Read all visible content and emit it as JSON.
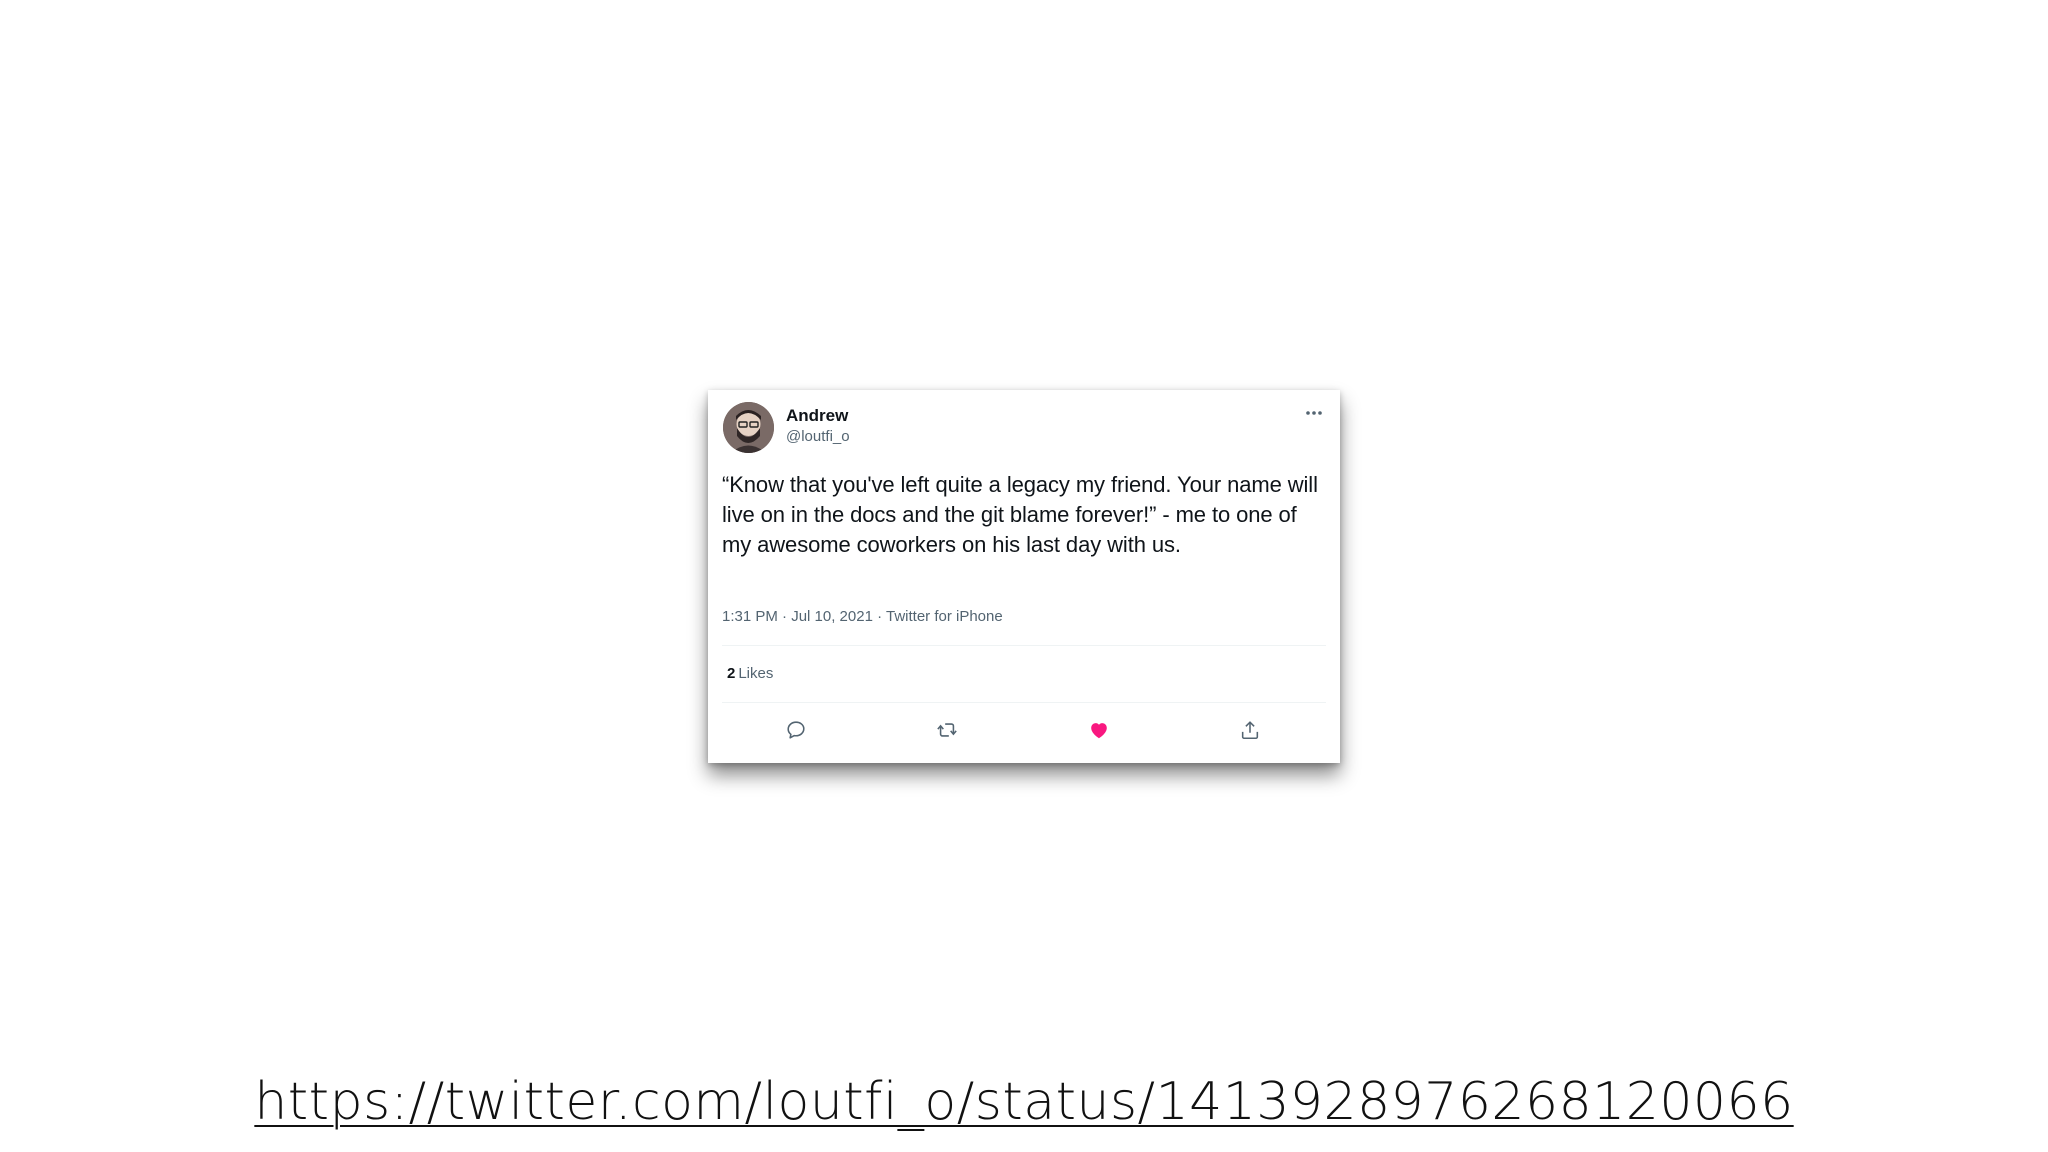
{
  "tweet": {
    "author_name": "Andrew",
    "author_handle": "@loutfi_o",
    "text": "“Know that you've left quite a legacy my friend. Your name will live on in the docs and the git blame forever!” - me to one of my awesome coworkers on his last day with us.",
    "meta": "1:31 PM · Jul 10, 2021 · Twitter for iPhone",
    "likes_count": "2",
    "likes_label": "Likes",
    "icons": {
      "more": "more-icon",
      "reply": "reply-icon",
      "retweet": "retweet-icon",
      "like": "heart-icon",
      "share": "share-icon"
    },
    "colors": {
      "like_active": "#f91880",
      "icon_muted": "#536471"
    }
  },
  "caption": {
    "url": "https://twitter.com/loutfi_o/status/1413928976268120066"
  }
}
